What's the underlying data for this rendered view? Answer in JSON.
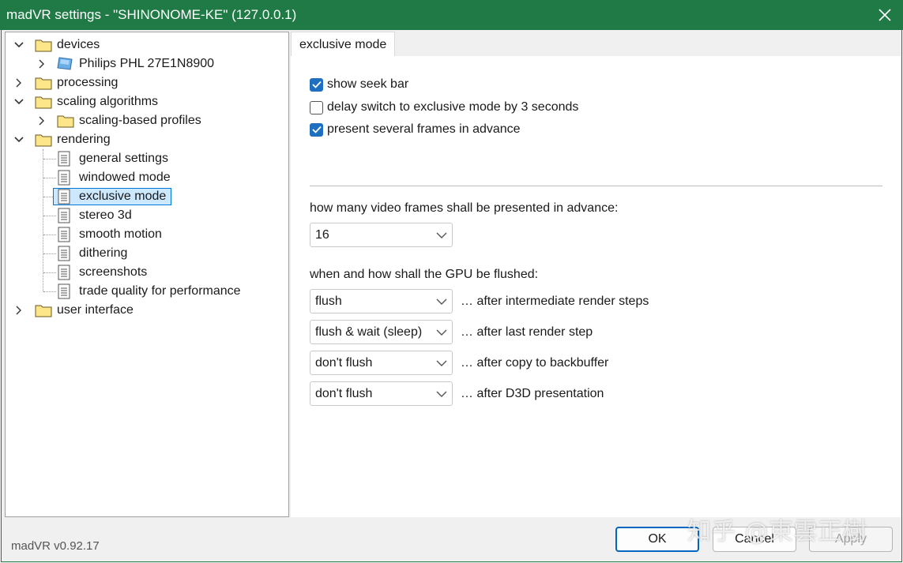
{
  "window": {
    "title": "madVR settings - \"SHINONOME-KE\" (127.0.0.1)"
  },
  "tree": {
    "devices": "devices",
    "monitor": "Philips PHL 27E1N8900",
    "processing": "processing",
    "scaling_algorithms": "scaling algorithms",
    "scaling_profiles": "scaling-based profiles",
    "rendering": "rendering",
    "general_settings": "general settings",
    "windowed_mode": "windowed mode",
    "exclusive_mode": "exclusive mode",
    "stereo_3d": "stereo 3d",
    "smooth_motion": "smooth motion",
    "dithering": "dithering",
    "screenshots": "screenshots",
    "trade_quality": "trade quality for performance",
    "user_interface": "user interface"
  },
  "tab": {
    "label": "exclusive mode"
  },
  "options": {
    "show_seek_bar": {
      "label": "show seek bar",
      "checked": true
    },
    "delay_switch": {
      "label": "delay switch to exclusive mode by 3 seconds",
      "checked": false
    },
    "present_frames": {
      "label": "present several frames in advance",
      "checked": true
    }
  },
  "frames": {
    "label": "how many video frames shall be presented in advance:",
    "value": "16"
  },
  "flush": {
    "label": "when and how shall the GPU be flushed:",
    "rows": [
      {
        "value": "flush",
        "suffix": "… after intermediate render steps"
      },
      {
        "value": "flush & wait (sleep)",
        "suffix": "… after last render step"
      },
      {
        "value": "don't flush",
        "suffix": "… after copy to backbuffer"
      },
      {
        "value": "don't flush",
        "suffix": "… after D3D presentation"
      }
    ]
  },
  "footer": {
    "version": "madVR v0.92.17",
    "ok": "OK",
    "cancel": "Cancel",
    "apply": "Apply"
  },
  "watermark": "知乎 @東雲正樹",
  "colors": {
    "titlebar": "#1f7a45",
    "checkbox": "#1f6fc0",
    "selection": "#cce8ff"
  }
}
